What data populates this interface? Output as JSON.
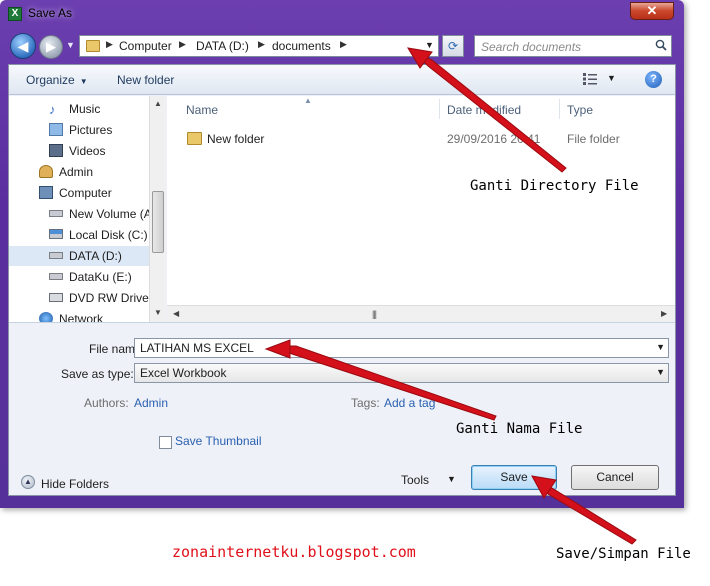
{
  "window": {
    "title": "Save As",
    "app_icon_letter": "X",
    "close_glyph": "✕"
  },
  "address": {
    "crumbs": [
      "Computer",
      "DATA (D:)",
      "documents"
    ],
    "search_placeholder": "Search documents"
  },
  "toolbar": {
    "organize_label": "Organize",
    "new_folder_label": "New folder"
  },
  "nav": {
    "items": [
      {
        "label": "Music",
        "icon": "music-icon"
      },
      {
        "label": "Pictures",
        "icon": "pictures-icon"
      },
      {
        "label": "Videos",
        "icon": "videos-icon"
      },
      {
        "label": "Admin",
        "icon": "user-icon"
      },
      {
        "label": "Computer",
        "icon": "computer-icon"
      },
      {
        "label": "New Volume (A",
        "icon": "drive-icon"
      },
      {
        "label": "Local Disk (C:)",
        "icon": "system-drive-icon"
      },
      {
        "label": "DATA (D:)",
        "icon": "drive-icon"
      },
      {
        "label": "DataKu (E:)",
        "icon": "drive-icon"
      },
      {
        "label": "DVD RW Drive (",
        "icon": "dvd-icon"
      },
      {
        "label": "Network",
        "icon": "network-icon"
      }
    ],
    "selected_index": 7
  },
  "filelist": {
    "columns": [
      "Name",
      "Date modified",
      "Type"
    ],
    "rows": [
      {
        "name": "New folder",
        "date": "29/09/2016 20:41",
        "type": "File folder"
      }
    ]
  },
  "form": {
    "file_name_label": "File name:",
    "file_name_value": "LATIHAN MS EXCEL",
    "save_type_label": "Save as type:",
    "save_type_value": "Excel Workbook",
    "authors_label": "Authors:",
    "authors_value": "Admin",
    "tags_label": "Tags:",
    "tags_value": "Add a tag",
    "thumbnail_label": "Save Thumbnail",
    "hide_folders_label": "Hide Folders",
    "tools_label": "Tools",
    "save_label": "Save",
    "cancel_label": "Cancel"
  },
  "annotations": {
    "directory": "Ganti Directory File",
    "filename": "Ganti Nama File",
    "save": "Save/Simpan File",
    "blog": "zonainternetku.blogspot.com",
    "arrow_color": "#d4101a"
  }
}
